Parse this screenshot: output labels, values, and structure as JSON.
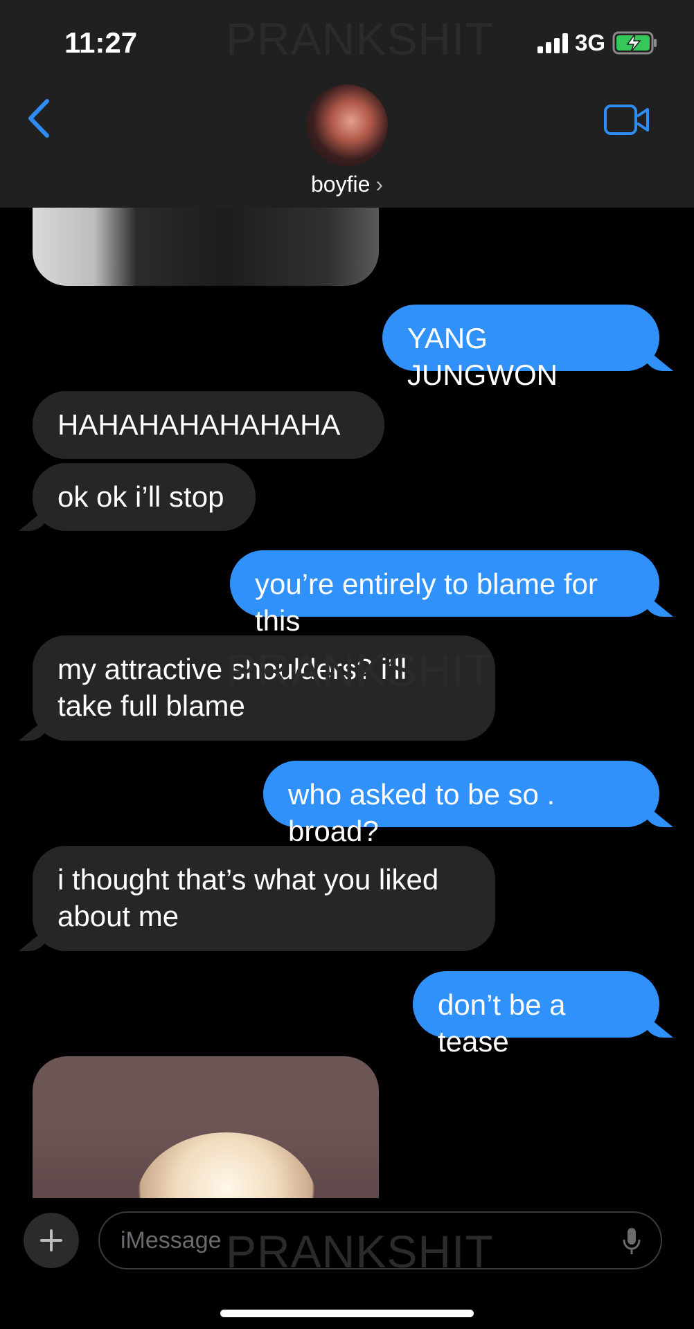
{
  "status_bar": {
    "time": "11:27",
    "network": "3G"
  },
  "header": {
    "contact_name": "boyfie"
  },
  "watermark": "PRANKSHIT",
  "messages": [
    {
      "from": "me",
      "text": "YANG JUNGWON"
    },
    {
      "from": "them",
      "text": "HAHAHAHAHAHAHA"
    },
    {
      "from": "them",
      "text": "ok ok i’ll stop"
    },
    {
      "from": "me",
      "text": "you’re entirely to blame for this"
    },
    {
      "from": "them",
      "text": "my attractive shoulders? i’ll\ntake full blame"
    },
    {
      "from": "me",
      "text": "who asked to be so . broad?"
    },
    {
      "from": "them",
      "text": "i thought that’s what you liked\nabout me"
    },
    {
      "from": "me",
      "text": "don’t be a tease"
    }
  ],
  "composer": {
    "placeholder": "iMessage"
  },
  "colors": {
    "outgoing": "#3191fb",
    "incoming": "#262628",
    "accent": "#2f8cf5"
  },
  "icons": [
    "back-chevron-icon",
    "video-camera-icon",
    "plus-icon",
    "microphone-icon",
    "battery-charging-icon"
  ]
}
